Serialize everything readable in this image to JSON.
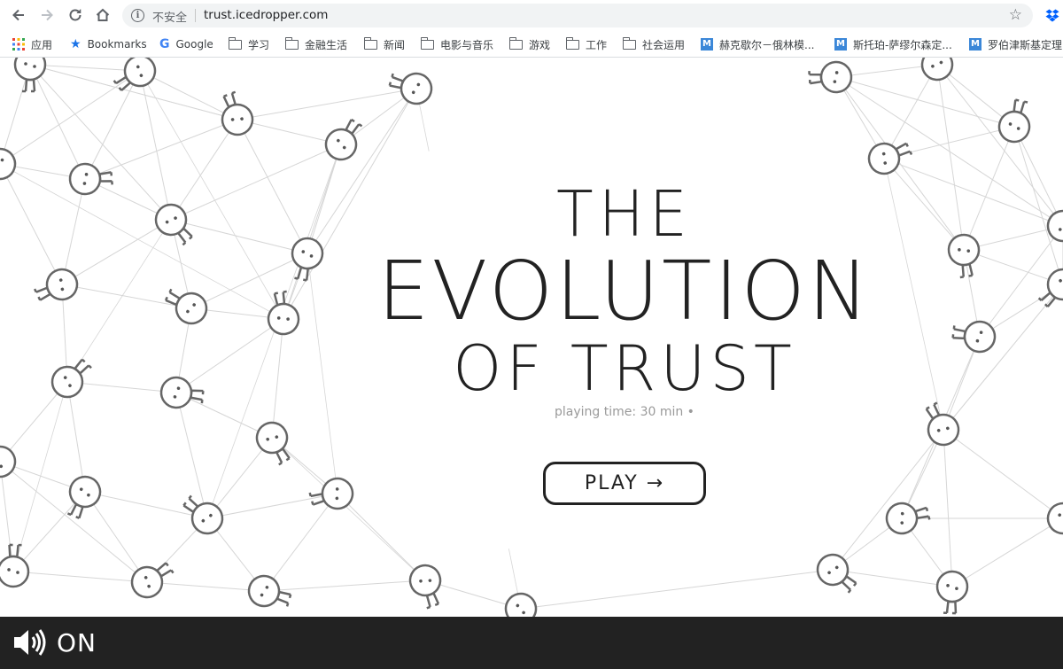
{
  "browser": {
    "security_label": "不安全",
    "url": "trust.icedropper.com",
    "bookmarks": [
      {
        "label": "应用",
        "icon": "apps-grid-icon"
      },
      {
        "label": "Bookmarks",
        "icon": "star-icon"
      },
      {
        "label": "Google",
        "icon": "google-icon"
      },
      {
        "label": "学习",
        "icon": "folder-icon"
      },
      {
        "label": "金融生活",
        "icon": "folder-icon"
      },
      {
        "label": "新闻",
        "icon": "folder-icon"
      },
      {
        "label": "电影与音乐",
        "icon": "folder-icon"
      },
      {
        "label": "游戏",
        "icon": "folder-icon"
      },
      {
        "label": "工作",
        "icon": "folder-icon"
      },
      {
        "label": "社会运用",
        "icon": "folder-icon"
      },
      {
        "label": "赫克歇尔－俄林模...",
        "icon": "m-icon"
      },
      {
        "label": "斯托珀-萨缪尔森定...",
        "icon": "m-icon"
      },
      {
        "label": "罗伯津斯基定理",
        "icon": "m-icon"
      }
    ]
  },
  "page": {
    "title_line1": "THE",
    "title_line2": "EVOLUTION",
    "title_line3": "OF TRUST",
    "playing_time": "playing time: 30 min •",
    "play_label": "PLAY →"
  },
  "sound": {
    "label": "ON",
    "icon": "speaker-icon"
  },
  "colors": {
    "ink": "#222222",
    "network_line": "#d6d6d6",
    "bar": "#222222"
  }
}
